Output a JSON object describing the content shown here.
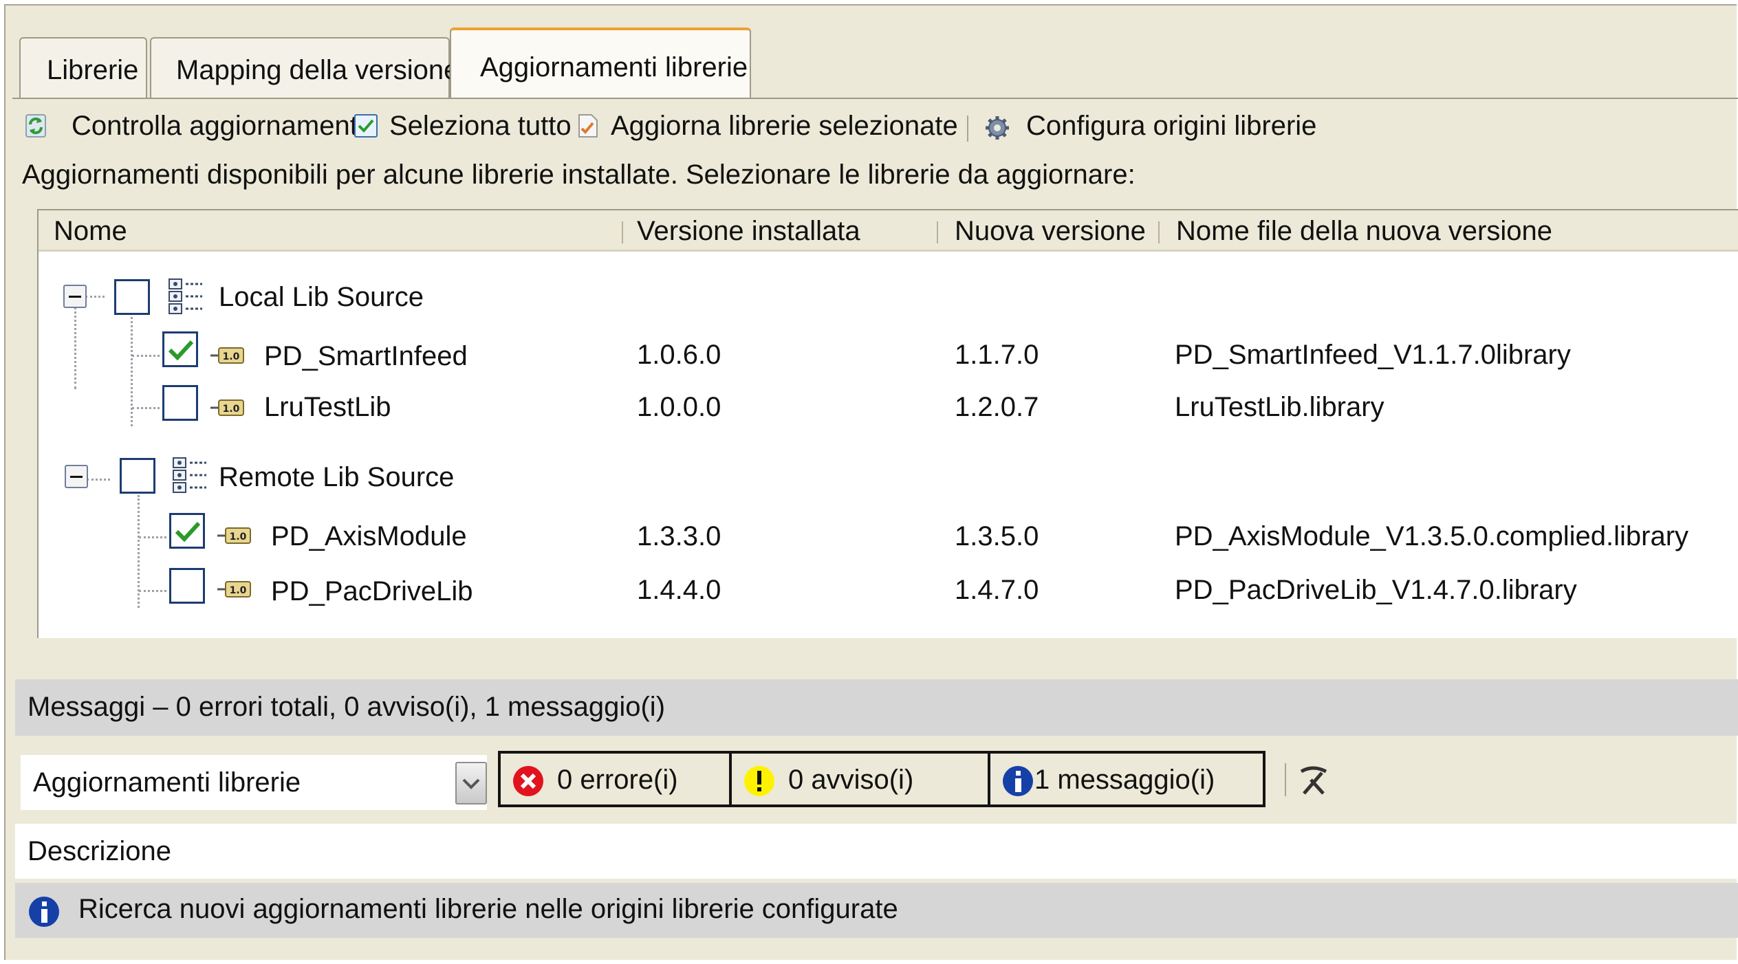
{
  "tabs": [
    {
      "label": "Librerie",
      "active": false
    },
    {
      "label": "Mapping della versione",
      "active": false
    },
    {
      "label": "Aggiornamenti librerie",
      "active": true
    }
  ],
  "toolbar": {
    "check_updates": {
      "label": "Controlla aggiornamenti",
      "icon": "refresh-icon"
    },
    "select_all": {
      "label": "Seleziona tutto",
      "icon": "checkbox-checked-icon"
    },
    "update_selected": {
      "label": "Aggiorna librerie selezionate",
      "icon": "document-update-icon"
    },
    "configure_sources": {
      "label": "Configura origini librerie",
      "icon": "gear-icon"
    }
  },
  "info_text": "Aggiornamenti disponibili per alcune librerie installate. Selezionare le librerie da aggiornare:",
  "grid": {
    "columns": [
      "Nome",
      "Versione installata",
      "Nuova versione",
      "Nome file della nuova versione"
    ],
    "groups": [
      {
        "name": "Local Lib Source",
        "checked": false,
        "expanded": true,
        "items": [
          {
            "name": "PD_SmartInfeed",
            "installed": "1.0.6.0",
            "new_version": "1.1.7.0",
            "file": "PD_SmartInfeed_V1.1.7.0library",
            "checked": true
          },
          {
            "name": "LruTestLib",
            "installed": "1.0.0.0",
            "new_version": "1.2.0.7",
            "file": "LruTestLib.library",
            "checked": false
          }
        ]
      },
      {
        "name": "Remote Lib Source",
        "checked": false,
        "expanded": true,
        "items": [
          {
            "name": "PD_AxisModule",
            "installed": "1.3.3.0",
            "new_version": "1.3.5.0",
            "file": "PD_AxisModule_V1.3.5.0.complied.library",
            "checked": true
          },
          {
            "name": "PD_PacDriveLib",
            "installed": "1.4.4.0",
            "new_version": "1.4.7.0",
            "file": "PD_PacDriveLib_V1.4.7.0.library",
            "checked": false
          }
        ]
      }
    ],
    "lib_icon_label": "1.0"
  },
  "messages": {
    "summary": "Messaggi – 0 errori totali, 0 avviso(i), 1 messaggio(i)",
    "filter_value": "Aggiornamenti librerie",
    "errors_label": "0 errore(i)",
    "warnings_label": "0 avviso(i)",
    "info_label": "1 messaggio(i)",
    "description_header": "Descrizione",
    "rows": [
      {
        "type": "info",
        "text": "Ricerca nuovi aggiornamenti librerie nelle origini librerie configurate"
      }
    ]
  },
  "colors": {
    "panel_bg": "#ece9d8",
    "active_tab_accent": "#f0a030",
    "checkbox_border": "#1c3c72",
    "check_green": "#2a9a2a",
    "error_red": "#e2121e",
    "warning_yellow": "#fff200",
    "info_blue": "#1540a8"
  }
}
